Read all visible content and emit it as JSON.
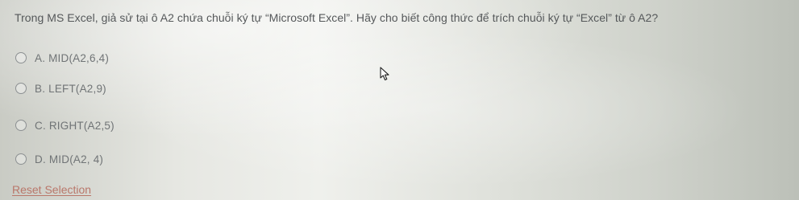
{
  "question": {
    "text": "Trong MS Excel, giả sử tại ô A2 chứa chuỗi ký tự “Microsoft Excel”. Hãy cho biết công thức để trích chuỗi ký tự “Excel” từ ô A2?"
  },
  "options": [
    {
      "label": "A. MID(A2,6,4)"
    },
    {
      "label": "B. LEFT(A2,9)"
    },
    {
      "label": "C. RIGHT(A2,5)"
    },
    {
      "label": "D. MID(A2, 4)"
    }
  ],
  "reset_label": "Reset Selection",
  "colors": {
    "question_text": "#55585a",
    "option_text": "#707476",
    "reset_link": "#b9776a"
  },
  "icons": {
    "radio": "radio-circle",
    "cursor": "mouse-pointer"
  }
}
